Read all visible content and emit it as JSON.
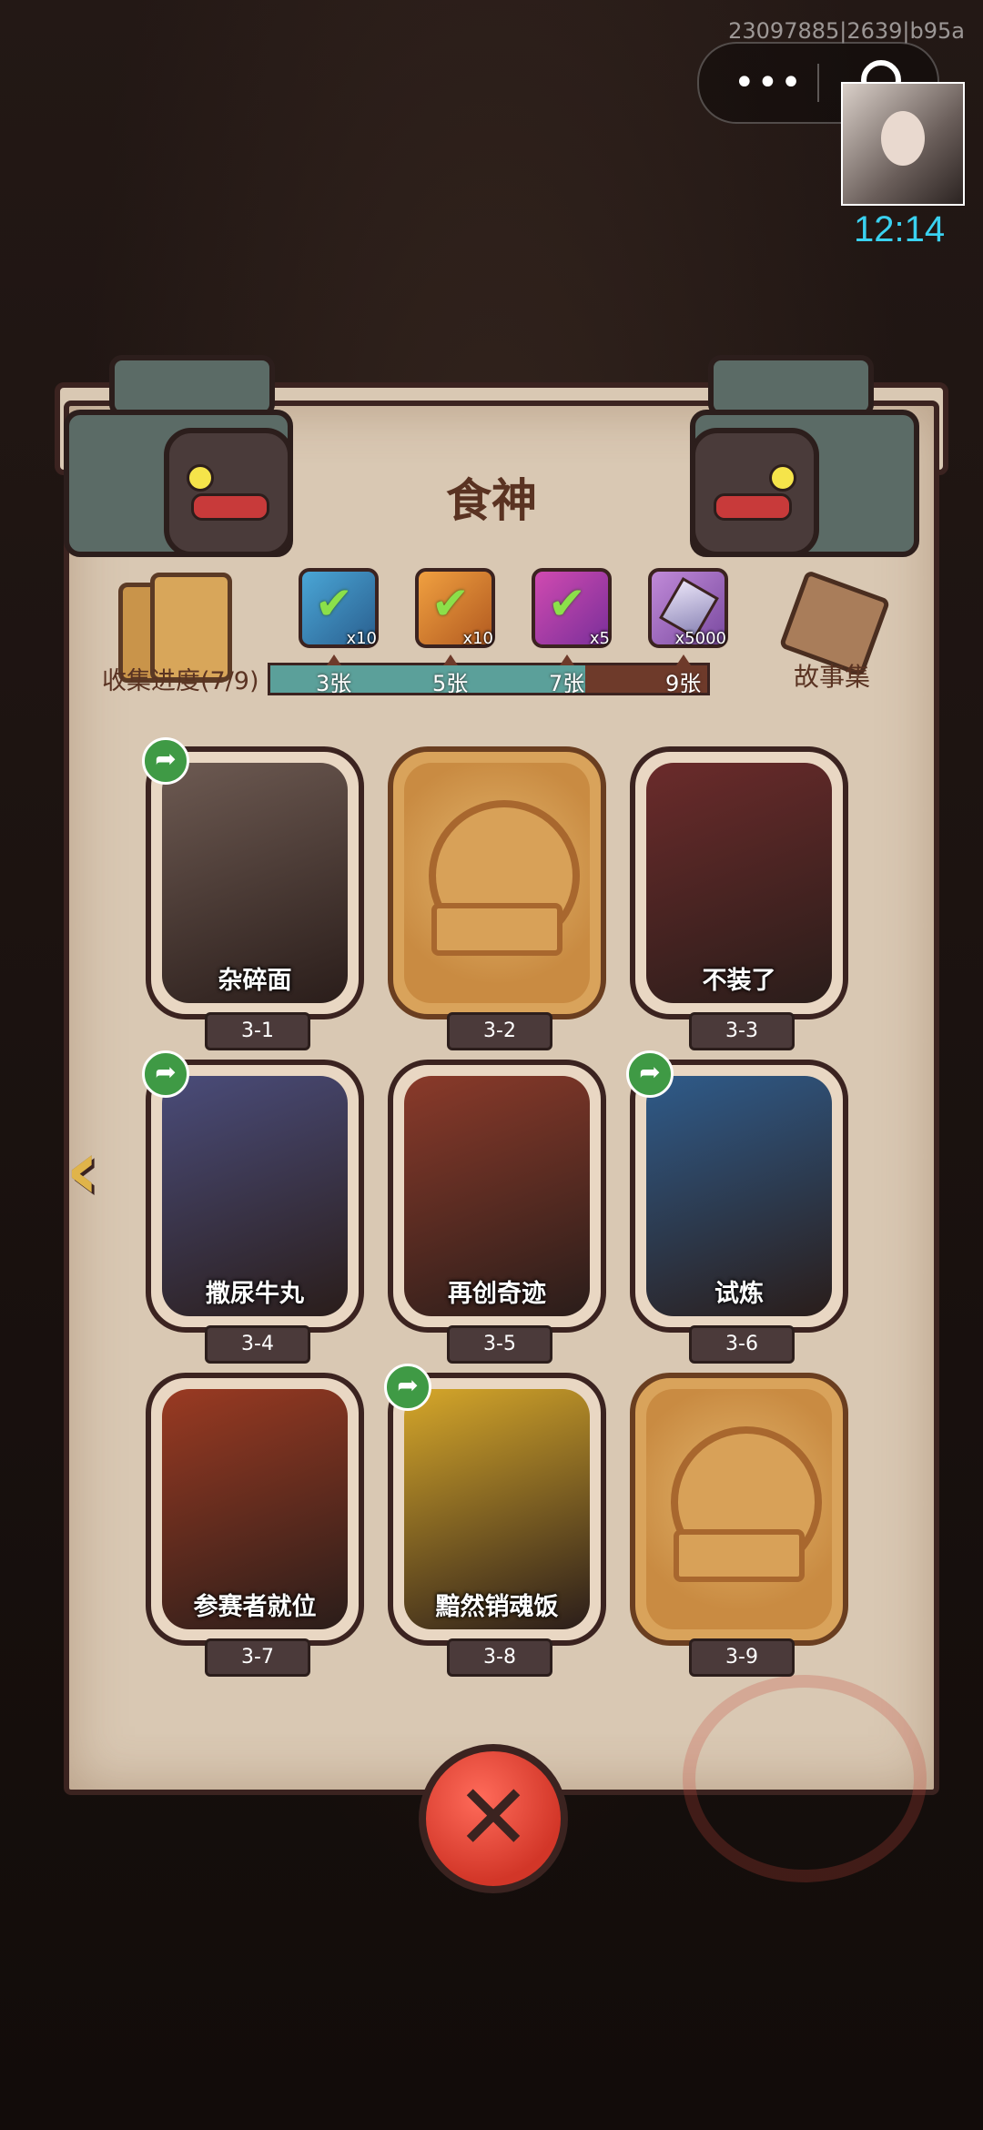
{
  "debug_id": "23097885|2639|b95a",
  "clock": "12:14",
  "panel": {
    "title": "食神",
    "progress_label": "收集进度(7/9)",
    "story_label": "故事集",
    "progress_fraction": 0.72
  },
  "rewards": [
    {
      "icon": "check-card-icon",
      "qty": "x10"
    },
    {
      "icon": "check-card-icon",
      "qty": "x10"
    },
    {
      "icon": "check-card-icon",
      "qty": "x5"
    },
    {
      "icon": "diamond-icon",
      "qty": "x5000"
    }
  ],
  "milestones": [
    "3张",
    "5张",
    "7张",
    "9张"
  ],
  "cards": [
    {
      "caption": "杂碎面",
      "tag": "3-1",
      "unlocked": true,
      "share": true,
      "color": "#6d5a52"
    },
    {
      "caption": "",
      "tag": "3-2",
      "unlocked": false,
      "share": false,
      "color": "#c98b42"
    },
    {
      "caption": "不装了",
      "tag": "3-3",
      "unlocked": true,
      "share": false,
      "color": "#6b2b2b"
    },
    {
      "caption": "撒尿牛丸",
      "tag": "3-4",
      "unlocked": true,
      "share": true,
      "color": "#4a4c7a"
    },
    {
      "caption": "再创奇迹",
      "tag": "3-5",
      "unlocked": true,
      "share": false,
      "color": "#8a3a2a"
    },
    {
      "caption": "试炼",
      "tag": "3-6",
      "unlocked": true,
      "share": true,
      "color": "#2f5b8a"
    },
    {
      "caption": "参赛者就位",
      "tag": "3-7",
      "unlocked": true,
      "share": false,
      "color": "#9a3a22"
    },
    {
      "caption": "黯然销魂饭",
      "tag": "3-8",
      "unlocked": true,
      "share": true,
      "color": "#d6a72a"
    },
    {
      "caption": "",
      "tag": "3-9",
      "unlocked": false,
      "share": false,
      "color": "#c98b42"
    }
  ],
  "icons": {
    "left_arrow": "left-chevron-icon",
    "close": "close-icon",
    "share": "share-icon"
  },
  "accents": {
    "progress_fill": "#5ba09a",
    "close_red": "#d23628",
    "clock_cyan": "#3ad1f0"
  }
}
